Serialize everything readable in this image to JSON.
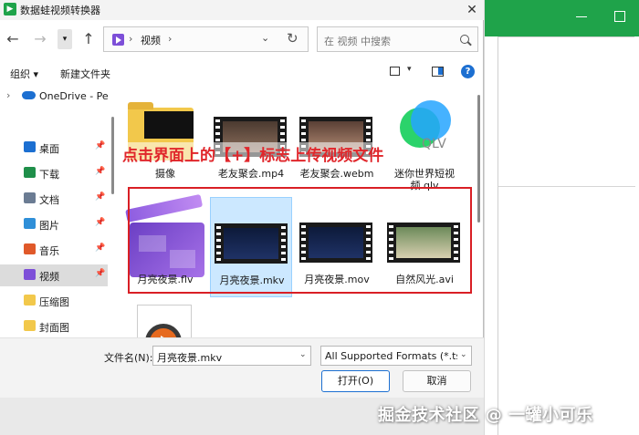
{
  "window": {
    "title": "数据蛙视频转换器",
    "close_glyph": "✕"
  },
  "nav": {
    "back": "←",
    "forward": "→",
    "up": "↑",
    "recent": "▾",
    "address": {
      "separator": "›",
      "current": "视频",
      "dropdown": "⌄",
      "refresh": "↻"
    },
    "search_placeholder": "在 视频 中搜索"
  },
  "toolbar": {
    "organize": "组织 ▾",
    "new_folder": "新建文件夹",
    "view_dropdown": "▾",
    "help": "?"
  },
  "sidebar": {
    "onedrive": {
      "arrow": "›",
      "label": "OneDrive - Per"
    },
    "items": [
      {
        "label": "桌面",
        "color": "#1c6fd1"
      },
      {
        "label": "下载",
        "color": "#1f8f4a"
      },
      {
        "label": "文档",
        "color": "#6b7c93"
      },
      {
        "label": "图片",
        "color": "#2f8fd8"
      },
      {
        "label": "音乐",
        "color": "#e0592a"
      },
      {
        "label": "视频",
        "color": "#7d4fd8"
      },
      {
        "label": "压缩图",
        "color": "#f2c84b"
      },
      {
        "label": "封面图",
        "color": "#f2c84b"
      }
    ],
    "pin": "📌"
  },
  "files": [
    {
      "name": "摄像",
      "kind": "folder"
    },
    {
      "name": "老友聚会.mp4",
      "kind": "film"
    },
    {
      "name": "老友聚会.webm",
      "kind": "film"
    },
    {
      "name": "迷你世界短视频.qlv",
      "kind": "qlv",
      "badge": "QLV"
    },
    {
      "name": "月亮夜景.flv",
      "kind": "flv"
    },
    {
      "name": "月亮夜景.mkv",
      "kind": "film",
      "selected": true
    },
    {
      "name": "月亮夜景.mov",
      "kind": "film"
    },
    {
      "name": "自然风光.avi",
      "kind": "film"
    },
    {
      "name": "",
      "kind": "media"
    }
  ],
  "annotation": "点击界面上的【+】标志上传视频文件",
  "bottom": {
    "filename_label": "文件名(N):",
    "filename_value": "月亮夜景.mkv",
    "dropdown": "⌄",
    "filetype": "All Supported Formats (*.ts;*",
    "open": "打开(O)",
    "cancel": "取消"
  },
  "watermark": "掘金技术社区 @ 一罐小可乐",
  "colors": {
    "accent": "#1c6fd1",
    "annotation": "#e0262b",
    "app_green": "#1fa34a",
    "selection": "#cce8ff"
  }
}
